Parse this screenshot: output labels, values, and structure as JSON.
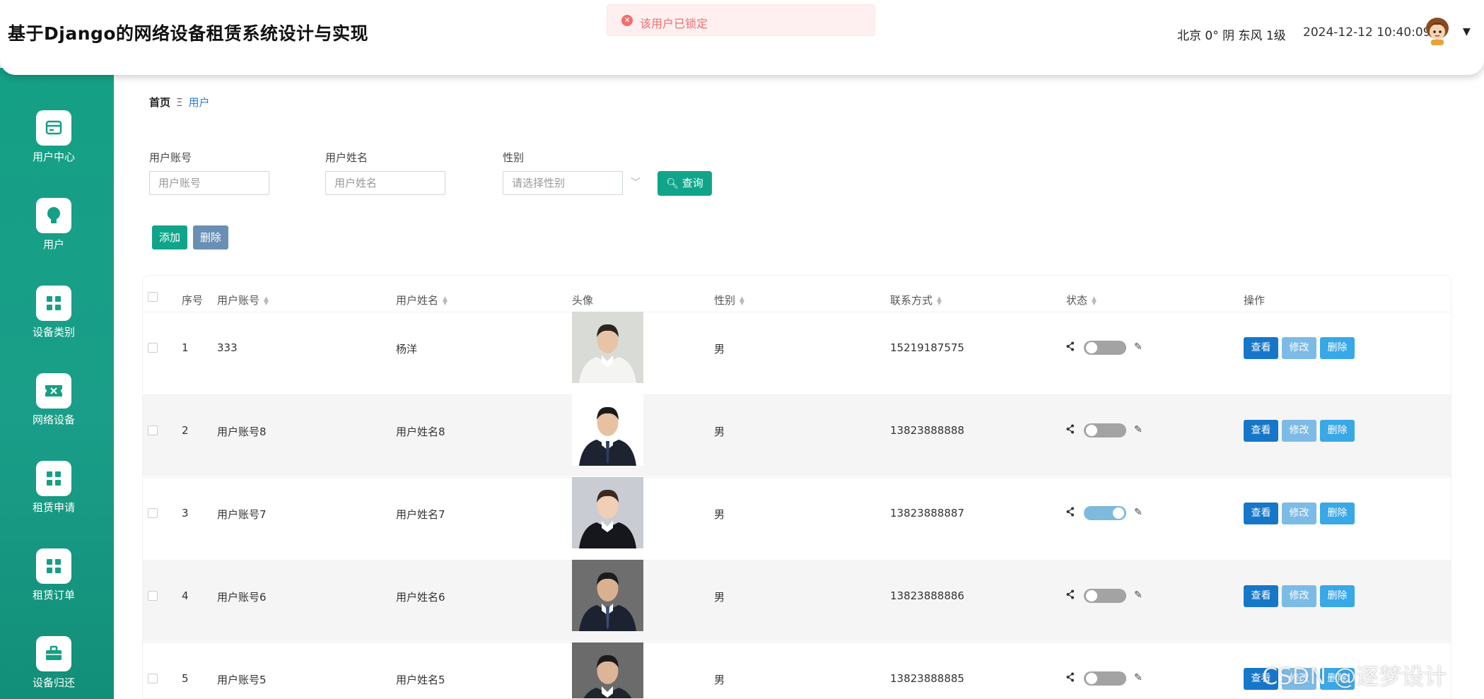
{
  "header": {
    "title": "基于Django的网络设备租赁系统设计与实现",
    "weather": "北京  0°  阴  东风  1级",
    "datetime": "2024-12-12 10:40:09",
    "avatar_icon": "user-avatar-cartoon",
    "dropdown_icon": "caret-down-icon"
  },
  "toast": {
    "message": "该用户已锁定",
    "color": "#f56c6c"
  },
  "sidebar": {
    "items": [
      {
        "label": "用户中心",
        "icon": "user-card-icon"
      },
      {
        "label": "用户",
        "icon": "bulb-icon"
      },
      {
        "label": "设备类别",
        "icon": "grid-icon"
      },
      {
        "label": "网络设备",
        "icon": "ticket-icon"
      },
      {
        "label": "租赁申请",
        "icon": "grid-icon"
      },
      {
        "label": "租赁订单",
        "icon": "grid-icon"
      },
      {
        "label": "设备归还",
        "icon": "briefcase-icon"
      }
    ],
    "accent": "#14a085"
  },
  "breadcrumb": {
    "home": "首页",
    "separator": "Ξ",
    "current": "用户"
  },
  "search": {
    "account_label": "用户账号",
    "account_placeholder": "用户账号",
    "name_label": "用户姓名",
    "name_placeholder": "用户姓名",
    "gender_label": "性别",
    "gender_placeholder": "请选择性别",
    "query_label": "查询"
  },
  "toolbar": {
    "add_label": "添加",
    "delete_label": "删除"
  },
  "table": {
    "headers": {
      "index": "序号",
      "account": "用户账号",
      "name": "用户姓名",
      "avatar": "头像",
      "gender": "性别",
      "phone": "联系方式",
      "status": "状态",
      "actions": "操作"
    },
    "rows": [
      {
        "index": "1",
        "account": "333",
        "name": "杨洋",
        "gender": "男",
        "phone": "15219187575",
        "status_on": false
      },
      {
        "index": "2",
        "account": "用户账号8",
        "name": "用户姓名8",
        "gender": "男",
        "phone": "13823888888",
        "status_on": false
      },
      {
        "index": "3",
        "account": "用户账号7",
        "name": "用户姓名7",
        "gender": "男",
        "phone": "13823888887",
        "status_on": true
      },
      {
        "index": "4",
        "account": "用户账号6",
        "name": "用户姓名6",
        "gender": "男",
        "phone": "13823888886",
        "status_on": false
      },
      {
        "index": "5",
        "account": "用户账号5",
        "name": "用户姓名5",
        "gender": "男",
        "phone": "13823888885",
        "status_on": false
      }
    ],
    "action_labels": {
      "view": "查看",
      "edit": "修改",
      "delete": "删除"
    }
  },
  "watermark": "CSDN @逐梦设计"
}
